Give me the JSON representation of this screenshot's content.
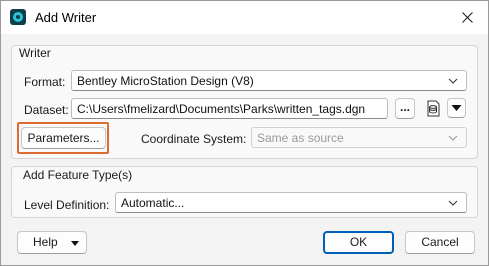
{
  "window": {
    "title": "Add Writer"
  },
  "writer_group": {
    "label": "Writer",
    "format_label": "Format:",
    "format_value": "Bentley MicroStation Design (V8)",
    "dataset_label": "Dataset:",
    "dataset_value": "C:\\Users\\fmelizard\\Documents\\Parks\\written_tags.dgn",
    "browse_label": "...",
    "parameters_label": "Parameters...",
    "coordinate_system_label": "Coordinate System:",
    "coordinate_system_value": "Same as source"
  },
  "feature_group": {
    "label": "Add Feature Type(s)",
    "level_definition_label": "Level Definition:",
    "level_definition_value": "Automatic..."
  },
  "footer": {
    "help_label": "Help",
    "ok_label": "OK",
    "cancel_label": "Cancel"
  },
  "icons": {
    "app": "fme-app-icon",
    "close": "close-icon",
    "dataset_tool": "database-file-icon",
    "dataset_menu": "triangle-down-icon"
  },
  "colors": {
    "highlight": "#e06b2e",
    "ok_border": "#005fb8",
    "app_icon_accent": "#29c4d6"
  }
}
